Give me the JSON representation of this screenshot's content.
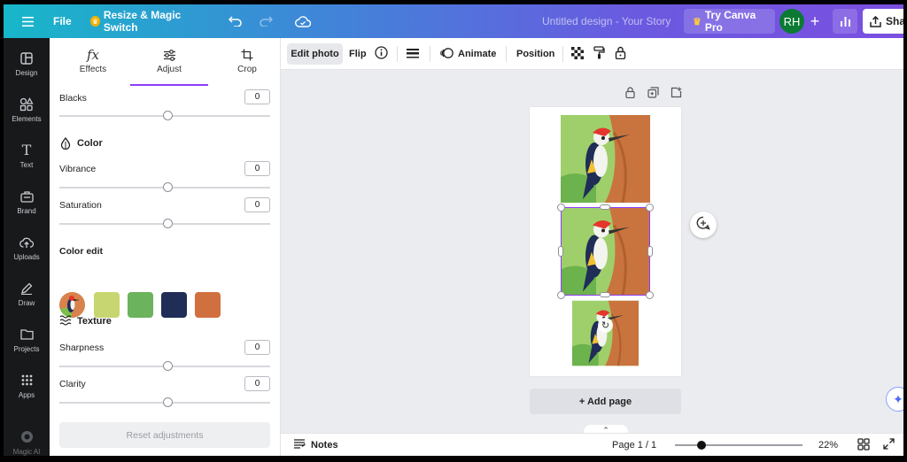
{
  "topbar": {
    "file_label": "File",
    "resize_label": "Resize & Magic Switch",
    "doc_title": "Untitled design - Your Story",
    "try_pro_label": "Try Canva Pro",
    "avatar_initials": "RH",
    "share_label": "Sha"
  },
  "rail": [
    {
      "label": "Design",
      "icon": "layout-icon"
    },
    {
      "label": "Elements",
      "icon": "shapes-icon"
    },
    {
      "label": "Text",
      "icon": "text-icon"
    },
    {
      "label": "Brand",
      "icon": "brand-icon"
    },
    {
      "label": "Uploads",
      "icon": "upload-icon"
    },
    {
      "label": "Draw",
      "icon": "pen-icon"
    },
    {
      "label": "Projects",
      "icon": "folder-icon"
    },
    {
      "label": "Apps",
      "icon": "apps-icon"
    },
    {
      "label": "Magic AI",
      "icon": "magic-icon"
    }
  ],
  "panel": {
    "tabs": [
      {
        "label": "Effects",
        "icon": "fx-icon"
      },
      {
        "label": "Adjust",
        "icon": "sliders-icon"
      },
      {
        "label": "Crop",
        "icon": "crop-icon"
      }
    ],
    "active_tab": "Adjust",
    "blacks": {
      "label": "Blacks",
      "value": "0"
    },
    "color_section": "Color",
    "vibrance": {
      "label": "Vibrance",
      "value": "0"
    },
    "saturation": {
      "label": "Saturation",
      "value": "0"
    },
    "color_edit": "Color edit",
    "swatches": [
      "#c8d672",
      "#6bb35d",
      "#1f2d57",
      "#d0703f"
    ],
    "texture_section": "Texture",
    "sharpness": {
      "label": "Sharpness",
      "value": "0"
    },
    "clarity": {
      "label": "Clarity",
      "value": "0"
    },
    "reset_label": "Reset adjustments"
  },
  "context_bar": {
    "edit_photo": "Edit photo",
    "flip": "Flip",
    "animate": "Animate",
    "position": "Position"
  },
  "canvas": {
    "add_page": "+ Add page"
  },
  "bottom": {
    "notes": "Notes",
    "page_indicator": "Page 1 / 1",
    "zoom": "22%"
  },
  "colors": {
    "accent": "#8b3dff",
    "rail_bg": "#18191b"
  }
}
